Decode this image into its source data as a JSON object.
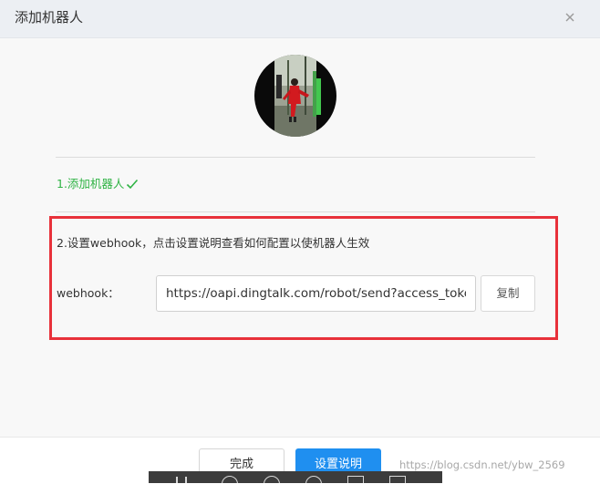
{
  "dialog": {
    "title": "添加机器人",
    "close_icon": "close-icon"
  },
  "steps": {
    "step1_label": "1.添加机器人",
    "step1_icon": "check-icon",
    "step2_label": "2.设置webhook，点击设置说明查看如何配置以使机器人生效"
  },
  "webhook": {
    "label": "webhook：",
    "value": "https://oapi.dingtalk.com/robot/send?access_token=",
    "copy_label": "复制"
  },
  "footer": {
    "done_label": "完成",
    "settings_label": "设置说明"
  },
  "watermark": {
    "text": "https://blog.csdn.net/ybw_2569"
  },
  "colors": {
    "success": "#2fb344",
    "primary": "#1f8ff0",
    "highlight": "#e8313a"
  }
}
